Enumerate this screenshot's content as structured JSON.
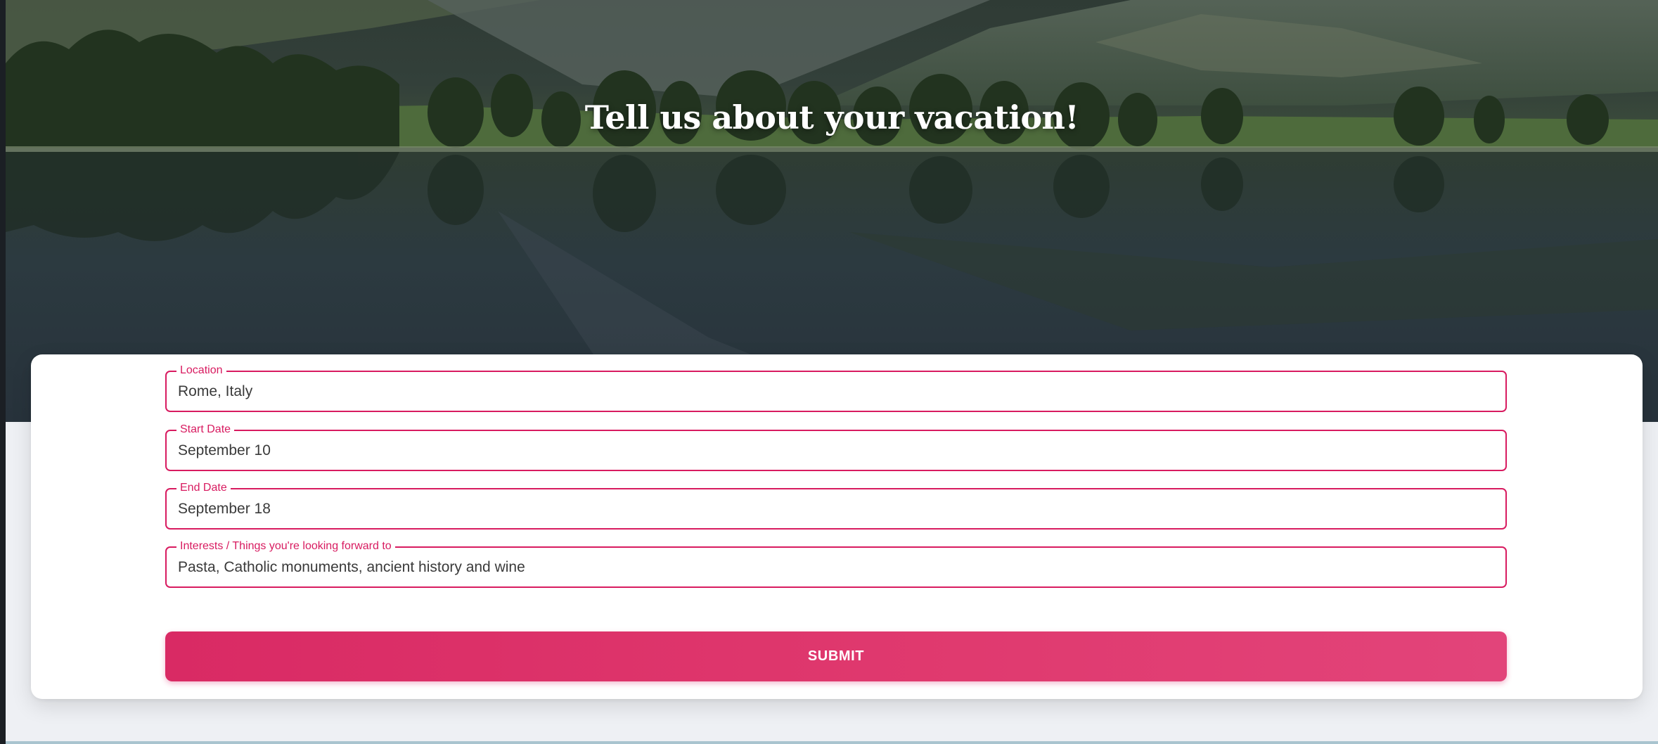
{
  "hero": {
    "title": "Tell us about your vacation!"
  },
  "form": {
    "fields": [
      {
        "label": "Location",
        "value": "Rome, Italy"
      },
      {
        "label": "Start Date",
        "value": "September 10"
      },
      {
        "label": "End Date",
        "value": "September 18"
      },
      {
        "label": "Interests / Things you're looking forward to",
        "value": "Pasta, Catholic monuments, ancient history and wine"
      }
    ],
    "submit_label": "SUBMIT"
  },
  "colors": {
    "accent": "#d81b60",
    "page_background": "#eef0f4",
    "card_background": "#ffffff"
  }
}
